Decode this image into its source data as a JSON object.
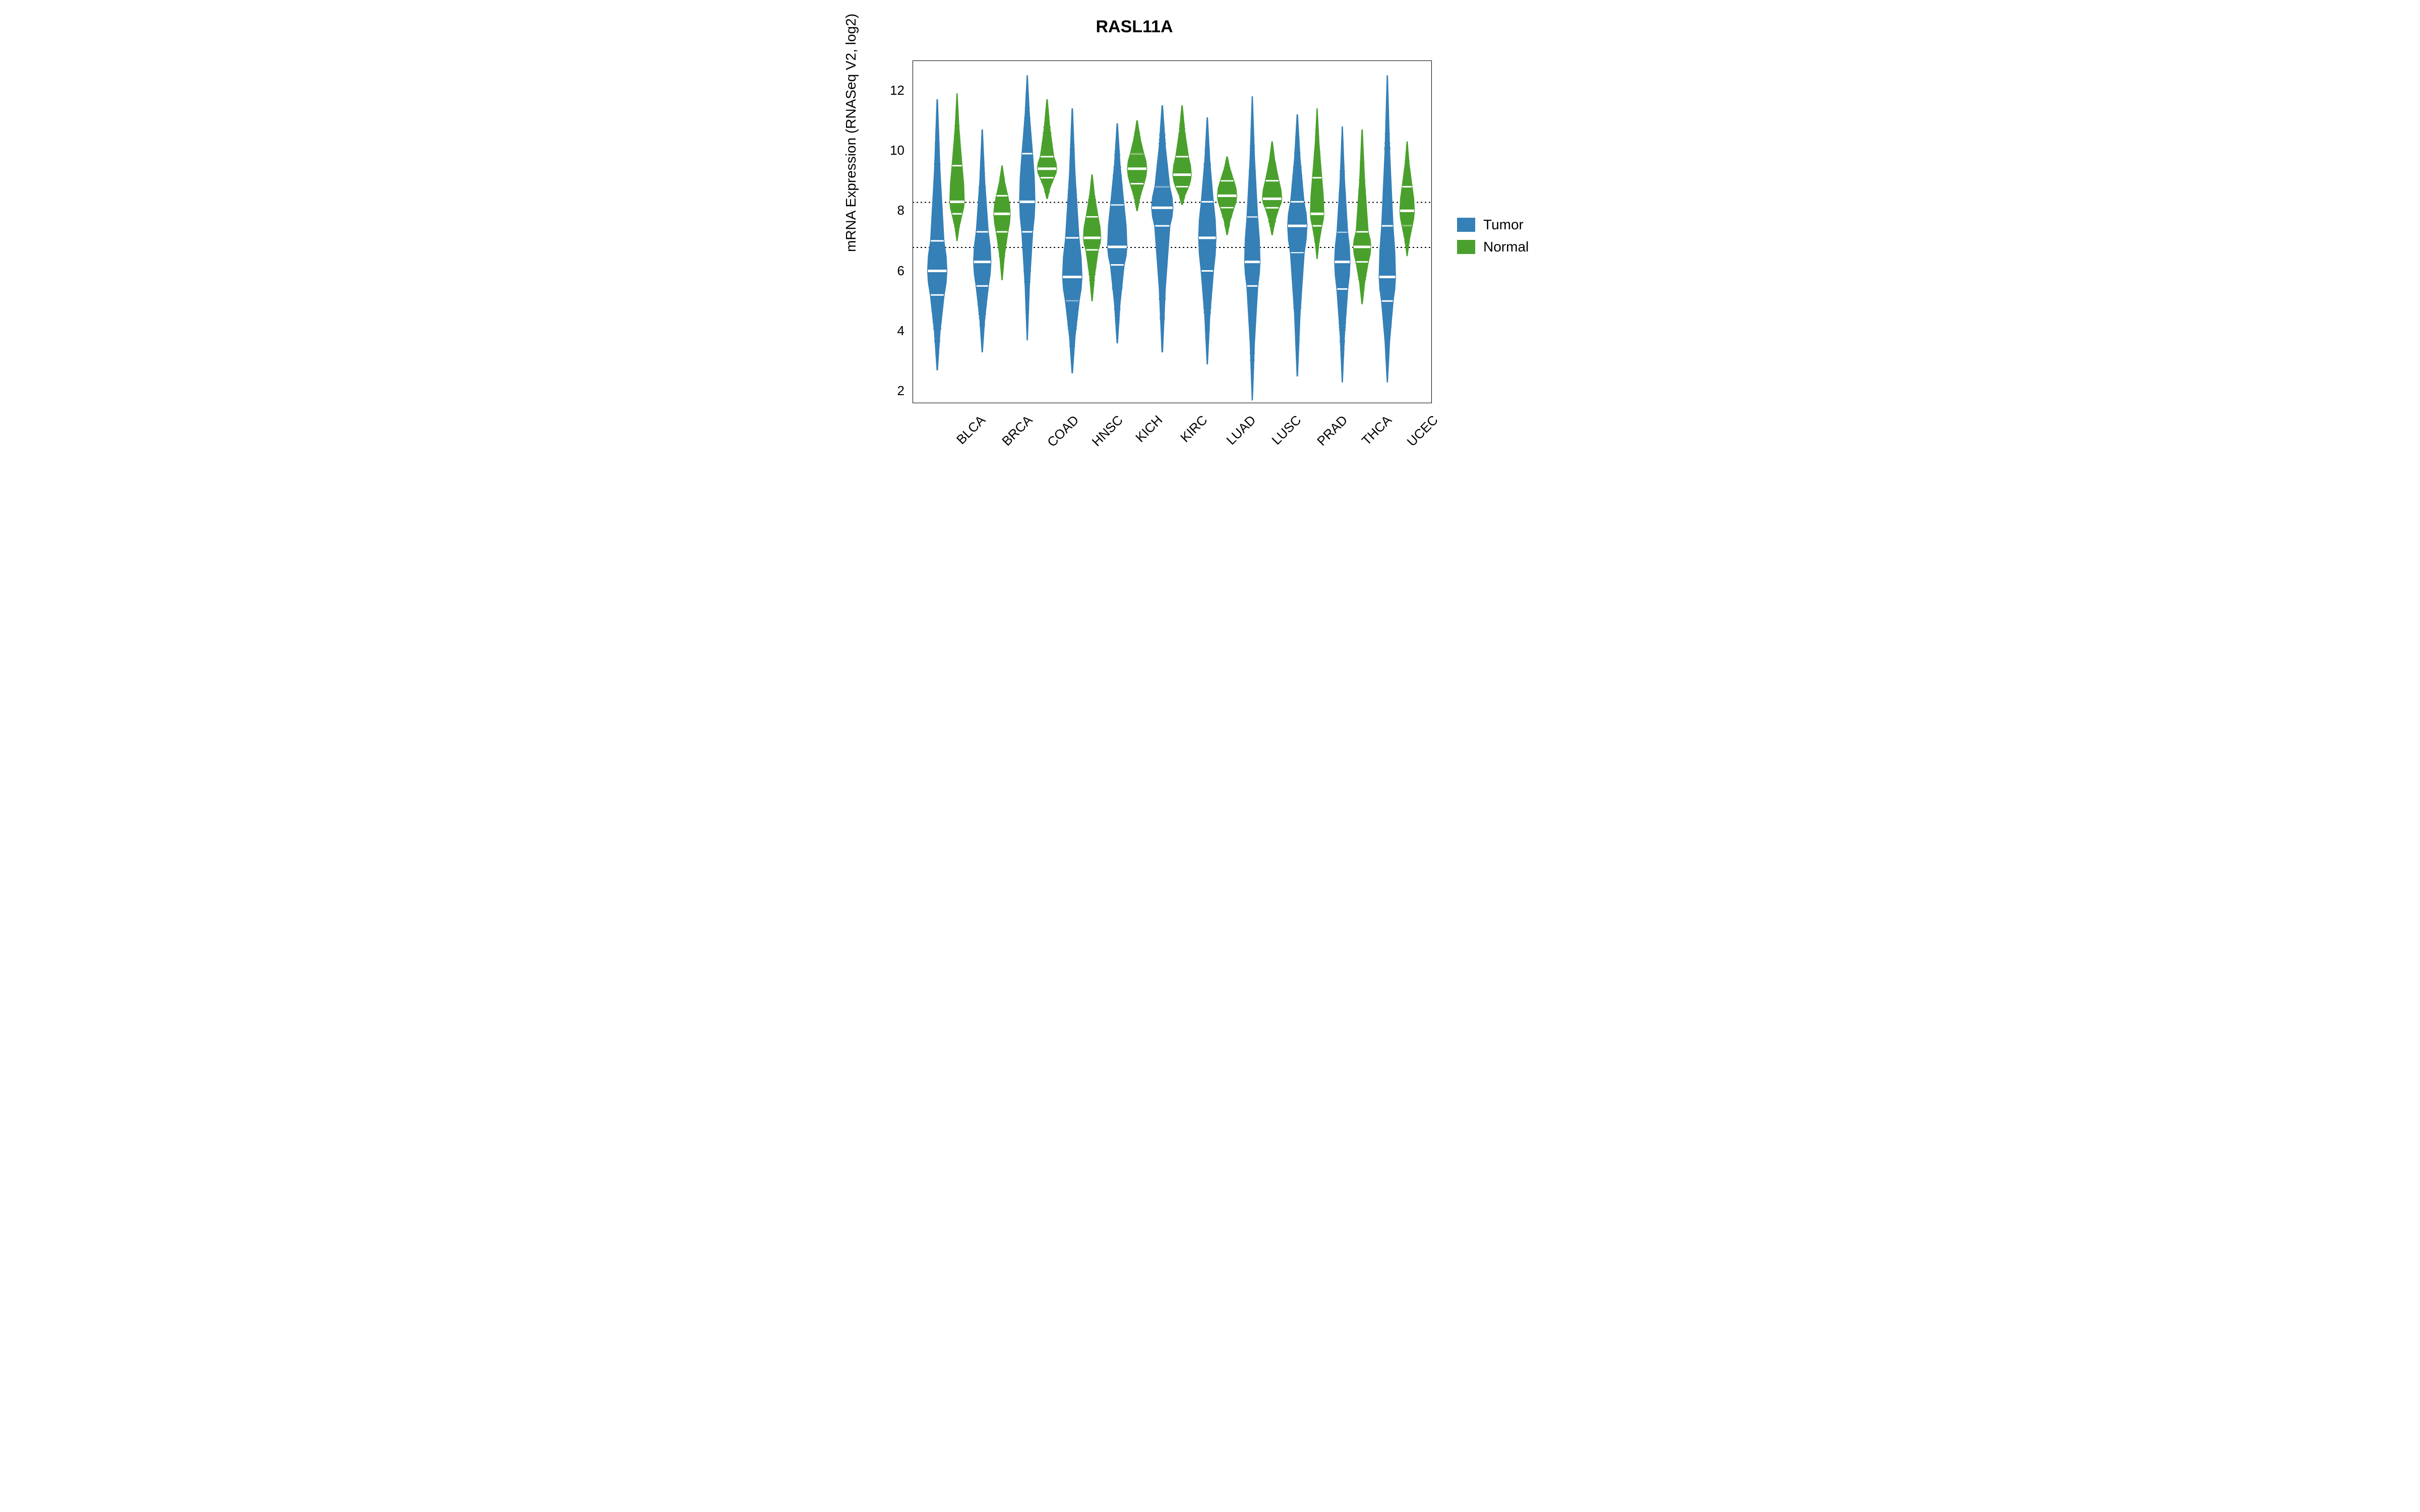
{
  "chart_data": {
    "type": "violin",
    "title": "RASL11A",
    "ylabel": "mRNA Expression (RNASeq V2, log2)",
    "ylim": [
      1.6,
      13.0
    ],
    "xlim_categories": [
      "BLCA",
      "BRCA",
      "COAD",
      "HNSC",
      "KICH",
      "KIRC",
      "LUAD",
      "LUSC",
      "PRAD",
      "THCA",
      "UCEC"
    ],
    "y_ticks": [
      2,
      4,
      6,
      8,
      10,
      12
    ],
    "reference_lines": [
      {
        "y": 6.78,
        "style": "dotted"
      },
      {
        "y": 8.28,
        "style": "dotted"
      }
    ],
    "legend": [
      {
        "name": "Tumor",
        "color": "#3580B7"
      },
      {
        "name": "Normal",
        "color": "#4AA02C"
      }
    ],
    "series": [
      {
        "name": "Tumor",
        "color": "#3580B7",
        "distributions": [
          {
            "category": "BLCA",
            "min": 2.7,
            "q1": 5.2,
            "median": 6.0,
            "q3": 7.0,
            "max": 11.7,
            "peak_width": 1.0
          },
          {
            "category": "BRCA",
            "min": 3.3,
            "q1": 5.5,
            "median": 6.3,
            "q3": 7.3,
            "max": 10.7,
            "peak_width": 0.9
          },
          {
            "category": "COAD",
            "min": 3.7,
            "q1": 7.3,
            "median": 8.3,
            "q3": 9.9,
            "max": 12.5,
            "peak_width": 0.8
          },
          {
            "category": "HNSC",
            "min": 2.6,
            "q1": 5.0,
            "median": 5.8,
            "q3": 7.1,
            "max": 11.4,
            "peak_width": 1.0
          },
          {
            "category": "KICH",
            "min": 3.6,
            "q1": 6.2,
            "median": 6.8,
            "q3": 8.2,
            "max": 10.9,
            "peak_width": 1.0
          },
          {
            "category": "KIRC",
            "min": 3.3,
            "q1": 7.5,
            "median": 8.1,
            "q3": 8.8,
            "max": 11.5,
            "peak_width": 1.1
          },
          {
            "category": "LUAD",
            "min": 2.9,
            "q1": 6.0,
            "median": 7.1,
            "q3": 8.3,
            "max": 11.1,
            "peak_width": 0.9
          },
          {
            "category": "LUSC",
            "min": 1.7,
            "q1": 5.5,
            "median": 6.3,
            "q3": 7.8,
            "max": 11.8,
            "peak_width": 0.8
          },
          {
            "category": "PRAD",
            "min": 2.5,
            "q1": 6.6,
            "median": 7.5,
            "q3": 8.3,
            "max": 11.2,
            "peak_width": 1.0
          },
          {
            "category": "THCA",
            "min": 2.3,
            "q1": 5.4,
            "median": 6.3,
            "q3": 7.3,
            "max": 10.8,
            "peak_width": 0.8
          },
          {
            "category": "UCEC",
            "min": 2.3,
            "q1": 5.0,
            "median": 5.8,
            "q3": 7.5,
            "max": 12.5,
            "peak_width": 0.85
          }
        ]
      },
      {
        "name": "Normal",
        "color": "#4AA02C",
        "distributions": [
          {
            "category": "BLCA",
            "min": 7.0,
            "q1": 7.9,
            "median": 8.3,
            "q3": 9.5,
            "max": 11.9,
            "peak_width": 0.75
          },
          {
            "category": "BRCA",
            "min": 5.7,
            "q1": 7.3,
            "median": 7.9,
            "q3": 8.5,
            "max": 9.5,
            "peak_width": 0.85
          },
          {
            "category": "COAD",
            "min": 8.4,
            "q1": 9.1,
            "median": 9.4,
            "q3": 9.8,
            "max": 11.7,
            "peak_width": 1.0
          },
          {
            "category": "HNSC",
            "min": 5.0,
            "q1": 6.7,
            "median": 7.1,
            "q3": 7.8,
            "max": 9.2,
            "peak_width": 0.9
          },
          {
            "category": "KICH",
            "min": 8.0,
            "q1": 8.9,
            "median": 9.4,
            "q3": 9.9,
            "max": 11.0,
            "peak_width": 1.0
          },
          {
            "category": "KIRC",
            "min": 8.2,
            "q1": 8.8,
            "median": 9.2,
            "q3": 9.8,
            "max": 11.5,
            "peak_width": 0.95
          },
          {
            "category": "LUAD",
            "min": 7.2,
            "q1": 8.1,
            "median": 8.5,
            "q3": 9.0,
            "max": 9.8,
            "peak_width": 1.0
          },
          {
            "category": "LUSC",
            "min": 7.2,
            "q1": 8.1,
            "median": 8.4,
            "q3": 9.0,
            "max": 10.3,
            "peak_width": 1.0
          },
          {
            "category": "PRAD",
            "min": 6.4,
            "q1": 7.5,
            "median": 7.9,
            "q3": 9.1,
            "max": 11.4,
            "peak_width": 0.7
          },
          {
            "category": "THCA",
            "min": 4.9,
            "q1": 6.3,
            "median": 6.8,
            "q3": 7.3,
            "max": 10.7,
            "peak_width": 0.9
          },
          {
            "category": "UCEC",
            "min": 6.5,
            "q1": 7.5,
            "median": 8.0,
            "q3": 8.8,
            "max": 10.3,
            "peak_width": 0.75
          }
        ]
      }
    ]
  }
}
